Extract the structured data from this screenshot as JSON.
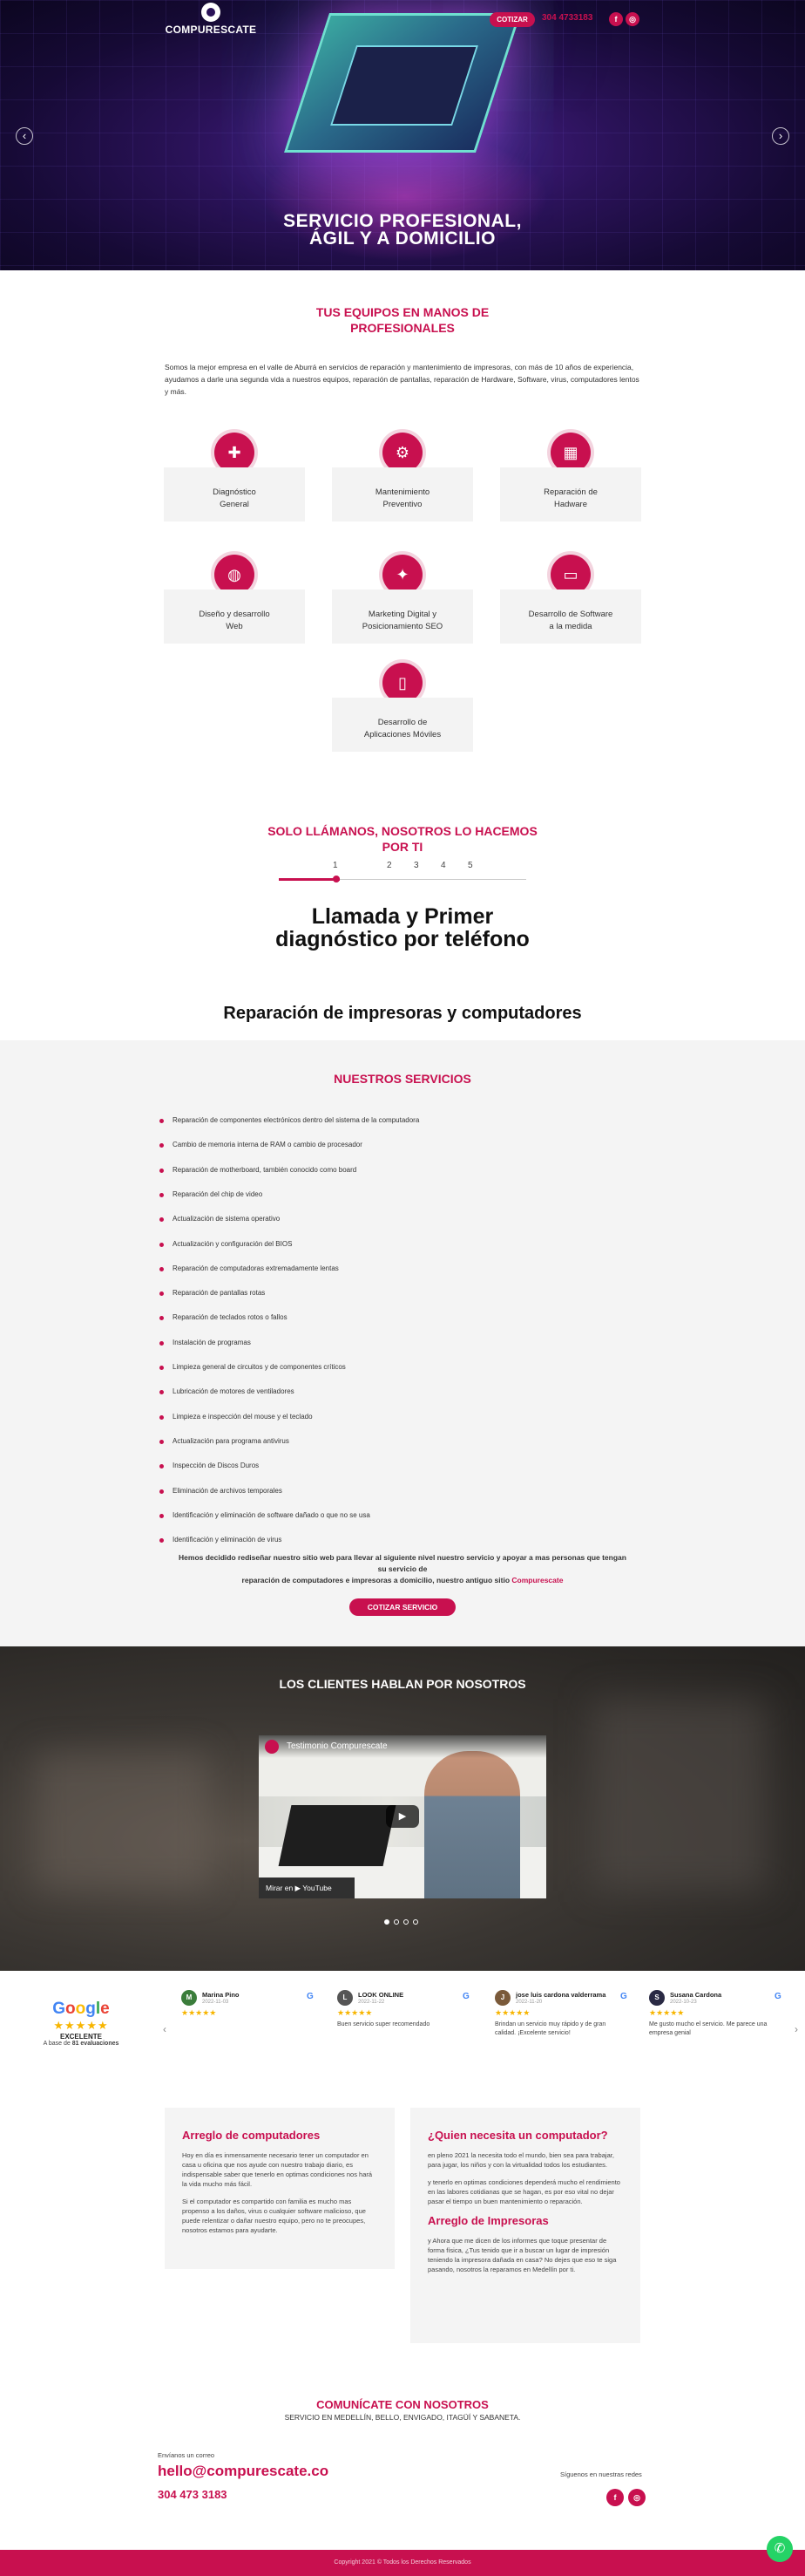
{
  "header": {
    "logo_text": "COMPURESCATE",
    "cotizar_label": "COTIZAR",
    "phone": "304 4733183",
    "facebook": "f",
    "instagram": "◎"
  },
  "hero": {
    "title_line1": "SERVICIO PROFESIONAL,",
    "title_line2": "ÁGIL Y A DOMICILIO",
    "prev_arrow": "‹",
    "next_arrow": "›"
  },
  "intro": {
    "title_line1": "TUS EQUIPOS EN MANOS DE",
    "title_line2": "PROFESIONALES",
    "text": "Somos la mejor empresa en el valle de Aburrá en servicios de reparación y mantenimiento de impresoras, con más de 10 años de experiencia, ayudamos a darle una segunda vida a nuestros equipos, reparación de pantallas, reparación de Hardware, Software, virus, computadores lentos y más."
  },
  "services_cards": [
    {
      "icon": "stethoscope-icon",
      "glyph": "✚",
      "line1": "Diagnóstico",
      "line2": "General"
    },
    {
      "icon": "wrench-icon",
      "glyph": "⚙",
      "line1": "Mantenimiento",
      "line2": "Preventivo"
    },
    {
      "icon": "chip-icon",
      "glyph": "▦",
      "line1": "Reparación de",
      "line2": "Hadware"
    },
    {
      "icon": "globe-icon",
      "glyph": "◍",
      "line1": "Diseño y desarrollo",
      "line2": "Web"
    },
    {
      "icon": "megaphone-icon",
      "glyph": "✦",
      "line1": "Marketing Digital y",
      "line2": "Posicionamiento SEO"
    },
    {
      "icon": "monitor-icon",
      "glyph": "▭",
      "line1": "Desarrollo de Software",
      "line2": "a la medida"
    },
    {
      "icon": "mobile-icon",
      "glyph": "▯",
      "line1": "Desarrollo de",
      "line2": "Aplicaciones Móviles"
    }
  ],
  "steps": {
    "title_line1": "SOLO LLÁMANOS, NOSOTROS LO HACEMOS",
    "title_line2": "POR TI",
    "numbers": [
      "1",
      "2",
      "3",
      "4",
      "5"
    ],
    "active_title_line1": "Llamada y Primer",
    "active_title_line2": "diagnóstico por teléfono"
  },
  "repair_title": "Reparación de impresoras y computadores",
  "services_list": {
    "title": "NUESTROS SERVICIOS",
    "items": [
      "Reparación de componentes electrónicos dentro del sistema de la computadora",
      "Cambio de memoria interna de RAM o cambio de procesador",
      "Reparación de motherboard, también conocido como board",
      "Reparación del chip de video",
      "Actualización de sistema operativo",
      "Actualización y configuración del BIOS",
      "Reparación de computadoras extremadamente lentas",
      "Reparación de pantallas rotas",
      "Reparación de teclados rotos o fallos",
      "Instalación de programas",
      "Limpieza general de circuitos y de componentes críticos",
      "Lubricación de motores de ventiladores",
      "Limpieza e inspección del mouse y el teclado",
      "Actualización para programa antivirus",
      "Inspección de Discos Duros",
      "Eliminación de archivos temporales",
      "Identificación y eliminación de software dañado o que no se usa",
      "Identificación y eliminación de virus"
    ],
    "note_line1": "Hemos decidido rediseñar nuestro sitio web para llevar al siguiente nivel nuestro servicio y apoyar a mas personas que tengan su servicio de",
    "note_line2": "reparación de computadores e impresoras a domicilio, nuestro antiguo sitio ",
    "note_link": "Compurescate",
    "cta": "COTIZAR SERVICIO"
  },
  "testimonials": {
    "title": "LOS CLIENTES HABLAN POR NOSOTROS",
    "video_title": "Testimonio Compurescate",
    "watch_on": "Mirar en  ▶ YouTube",
    "play": "▶"
  },
  "reviews": {
    "google_label": "Google",
    "rating_word": "EXCELENTE",
    "based_on_prefix": "A base de ",
    "count": "81 evaluaciones",
    "stars": "★★★★★",
    "items": [
      {
        "initial": "M",
        "color": "#3b7d3b",
        "name": "Marina Pino",
        "date": "2022-11-03",
        "text": ""
      },
      {
        "initial": "L",
        "color": "#555555",
        "name": "LOOK ONLINE",
        "date": "2022-11-22",
        "text": "Buen servicio super recomendado"
      },
      {
        "initial": "J",
        "color": "#7a5a3a",
        "name": "jose luis cardona valderrama",
        "date": "2022-11-20",
        "text": "Brindan un servicio muy rápido y de gran calidad. ¡Excelente servicio!"
      },
      {
        "initial": "S",
        "color": "#2a2a44",
        "name": "Susana Cardona",
        "date": "2022-10-23",
        "text": "Me gusto mucho el servicio. Me parece una empresa genial"
      }
    ],
    "prev": "‹",
    "next": "›",
    "g_mark": "G"
  },
  "articles": {
    "left_title": "Arreglo de computadores",
    "left_p1": "Hoy en día es inmensamente necesario tener un computador en casa u oficina que nos ayude con nuestro trabajo diario, es indispensable saber que tenerlo en optimas condiciones nos hará la vida mucho más fácil.",
    "left_p2": "Si el computador es compartido con familia es mucho mas propenso a los daños, virus o cualquier software malicioso, que puede relentizar o dañar nuestro equipo, pero no te preocupes, nosotros estamos para ayudarte.",
    "right_title": "¿Quien necesita un computador?",
    "right_p1": "en pleno 2021 la necesita todo el mundo, bien sea para trabajar, para jugar, los niños y con la virtualidad todos los estudiantes.",
    "right_p2": "y tenerlo en optimas condiciones dependerá mucho el rendimiento en las labores cotidianas que se hagan, es por eso vital no dejar pasar el tiempo un buen mantenimiento o reparación.",
    "right_title2": "Arreglo de Impresoras",
    "right_p3": "y Ahora que me dicen de los informes que toque presentar de forma física, ¿Tus tenido que ir a buscar un lugar de impresión teniendo la impresora dañada en casa? No dejes que eso te siga pasando, nosotros la reparamos en Medellín por ti."
  },
  "contact": {
    "title": "COMUNÍCATE CON NOSOTROS",
    "subtitle": "SERVICIO EN MEDELLÍN, BELLO, ENVIGADO, ITAGÜÍ Y SABANETA.",
    "email_label": "Envíanos un correo",
    "email": "hello@compurescate.co",
    "phone": "304 473 3183",
    "social_label": "Síguenos en nuestras redes"
  },
  "footer": {
    "text": "Copyright 2021 © Todos los Derechos Reservados"
  },
  "colors": {
    "accent": "#c8104f",
    "hero_dark": "#160a35",
    "whatsapp": "#25d366"
  }
}
